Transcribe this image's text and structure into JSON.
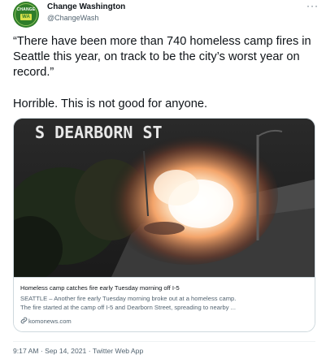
{
  "tweet": {
    "author": {
      "name": "Change Washington",
      "handle": "@ChangeWash",
      "avatar_top_text": "CHANGE",
      "avatar_badge_text": "WA"
    },
    "more_label": "···",
    "text_line1": "“There have been more than 740 homeless camp fires in Seattle this year, on track to be the city’s worst year on record.”",
    "text_line2": "Horrible. This is not good for anyone.",
    "card": {
      "image_overlay_text": "S DEARBORN ST",
      "title": "Homeless camp catches fire early Tuesday morning off I-5",
      "description_line1": "SEATTLE – Another fire early Tuesday morning broke out at a homeless camp.",
      "description_line2": "The fire started at the camp off I-5 and Dearborn Street, spreading to nearby ...",
      "link": "komonews.com",
      "link_icon": "link-icon"
    },
    "timestamp": "9:17 AM · Sep 14, 2021",
    "source": "Twitter Web App"
  },
  "colors": {
    "text": "#0f1419",
    "secondary": "#536471",
    "border": "#cfd9de",
    "avatar_green": "#2f7d2a"
  }
}
